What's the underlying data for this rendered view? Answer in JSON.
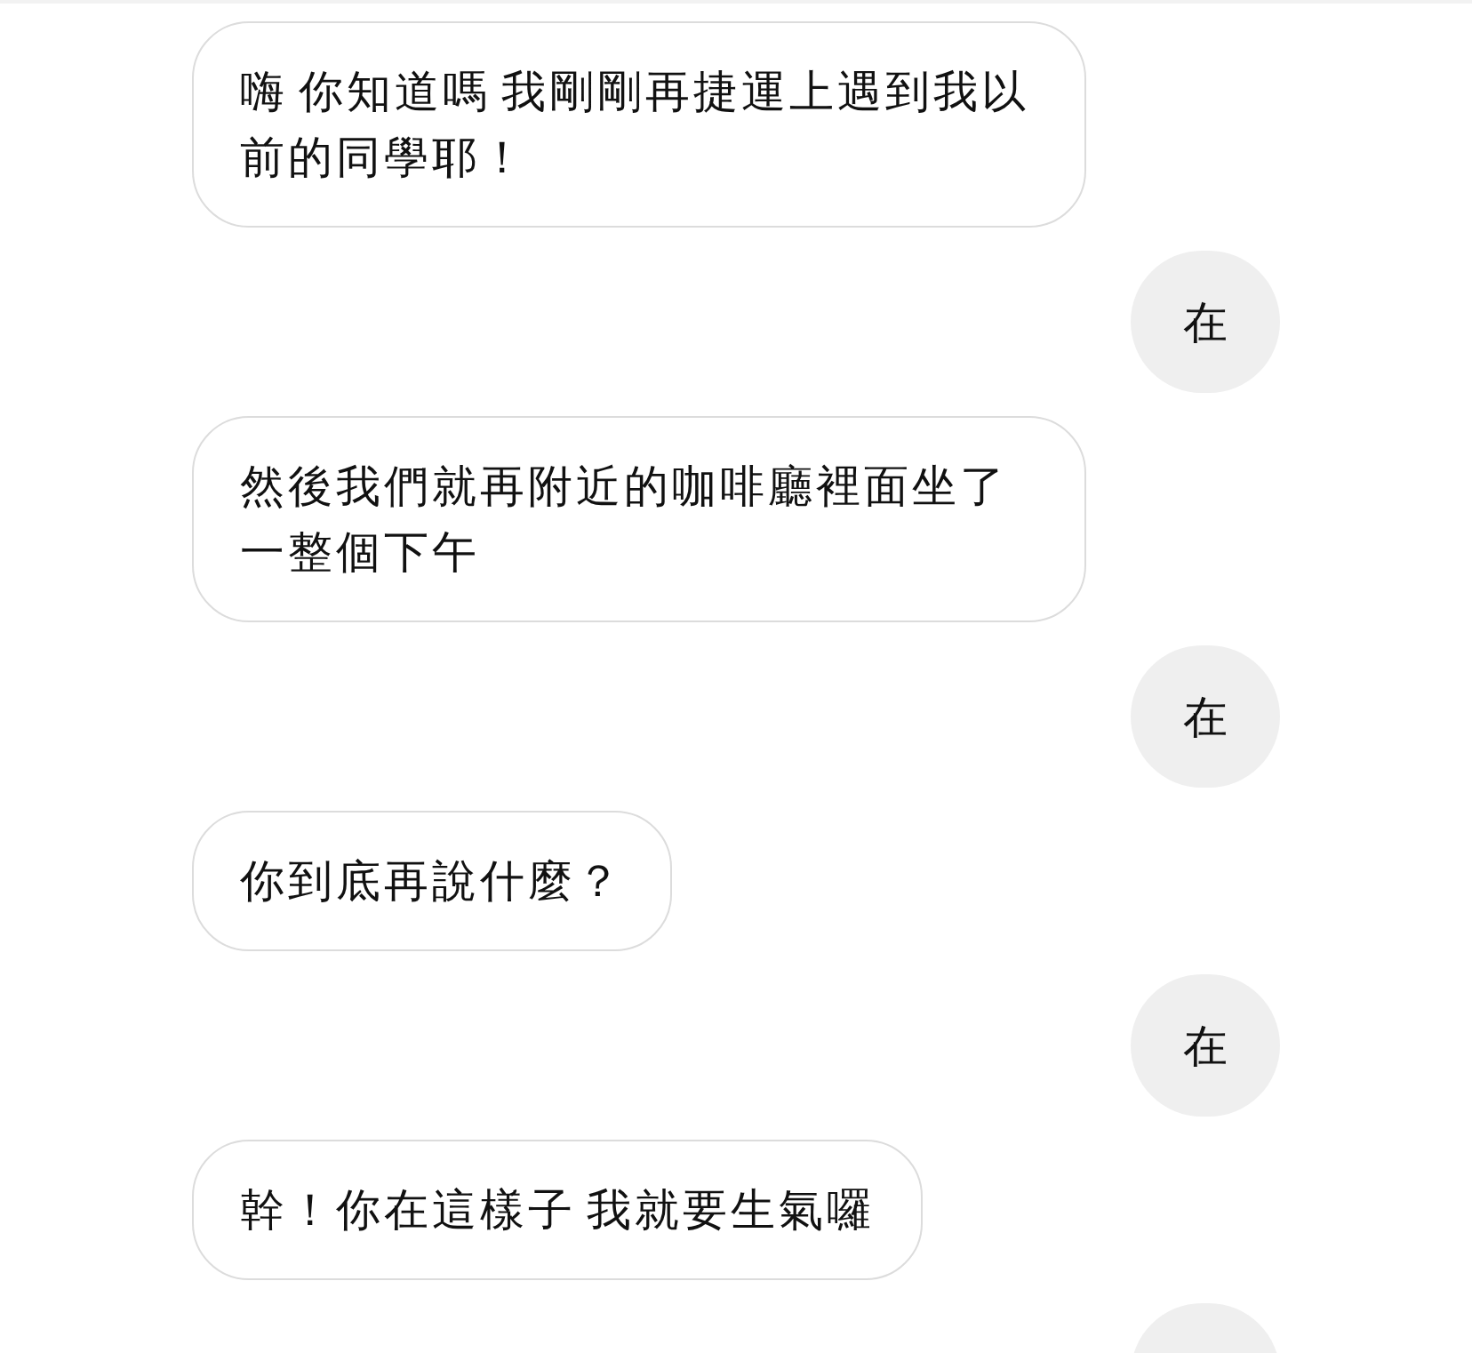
{
  "messages": [
    {
      "kind": "incoming",
      "text": "嗨 你知道嗎 我剛剛再捷運上遇到我以前的同學耶！"
    },
    {
      "kind": "outgoing",
      "text": "在"
    },
    {
      "kind": "incoming",
      "text": "然後我們就再附近的咖啡廳裡面坐了一整個下午"
    },
    {
      "kind": "outgoing",
      "text": "在"
    },
    {
      "kind": "incoming",
      "text": "你到底再說什麼？"
    },
    {
      "kind": "outgoing",
      "text": "在"
    },
    {
      "kind": "incoming",
      "text": "幹！你在這樣子 我就要生氣囉"
    }
  ]
}
